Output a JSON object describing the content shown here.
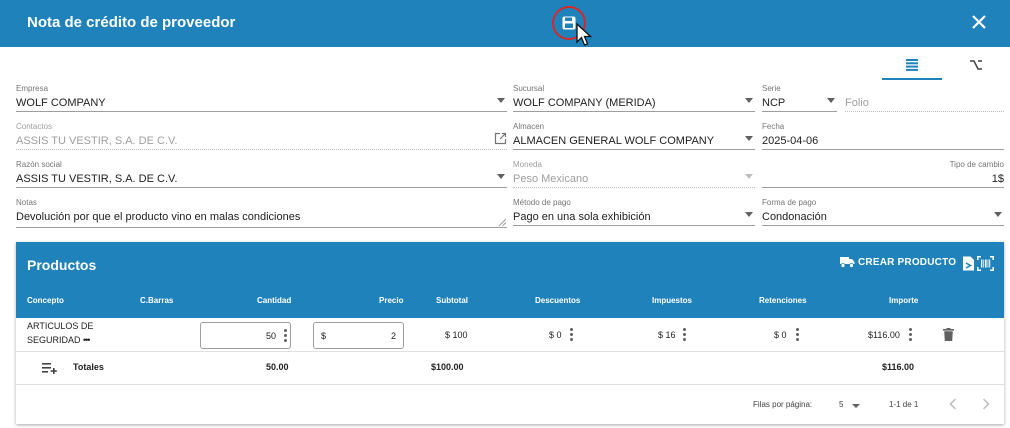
{
  "header": {
    "title": "Nota de crédito de proveedor"
  },
  "form": {
    "empresa": {
      "label": "Empresa",
      "value": "WOLF COMPANY"
    },
    "sucursal": {
      "label": "Sucursal",
      "value": "WOLF COMPANY (MERIDA)"
    },
    "serie": {
      "label": "Serie",
      "value": "NCP"
    },
    "folio": {
      "placeholder": "Folio"
    },
    "contactos": {
      "label": "Contactos",
      "value": "ASSIS TU VESTIR, S.A. DE C.V."
    },
    "almacen": {
      "label": "Almacen",
      "value": "ALMACEN GENERAL WOLF COMPANY"
    },
    "fecha": {
      "label": "Fecha",
      "value": "2025-04-06"
    },
    "razon_social": {
      "label": "Razón social",
      "value": "ASSIS TU VESTIR, S.A. DE C.V."
    },
    "moneda": {
      "label": "Moneda",
      "value": "Peso Mexicano"
    },
    "tipo_cambio": {
      "label": "Tipo de cambio",
      "value": "1$"
    },
    "notas": {
      "label": "Notas",
      "value": "Devolución por que el producto vino en malas condiciones"
    },
    "metodo_pago": {
      "label": "Método de pago",
      "value": "Pago en una sola exhibición"
    },
    "forma_pago": {
      "label": "Forma de pago",
      "value": "Condonación"
    }
  },
  "products": {
    "title": "Productos",
    "create_label": "CREAR PRODUCTO",
    "columns": {
      "concepto": "Concepto",
      "barras": "C.Barras",
      "cantidad": "Cantidad",
      "precio": "Precio",
      "subtotal": "Subtotal",
      "descuentos": "Descuentos",
      "impuestos": "Impuestos",
      "retenciones": "Retenciones",
      "importe": "Importe"
    },
    "rows": [
      {
        "concepto_l1": "ARTICULOS DE",
        "concepto_l2": "SEGURIDAD",
        "more": "•••",
        "cantidad": "50",
        "precio_prefix": "$",
        "precio": "2",
        "subtotal": "$ 100",
        "descuentos": "$ 0",
        "impuestos": "$ 16",
        "retenciones": "$ 0",
        "importe": "$116.00"
      }
    ],
    "totals": {
      "label": "Totales",
      "cantidad": "50.00",
      "subtotal": "$100.00",
      "importe": "$116.00"
    },
    "pagination": {
      "rows_label": "Filas por página:",
      "rows_value": "5",
      "range": "1-1 de 1"
    }
  },
  "colors": {
    "primary": "#1f82ba",
    "highlight": "#d62828"
  }
}
